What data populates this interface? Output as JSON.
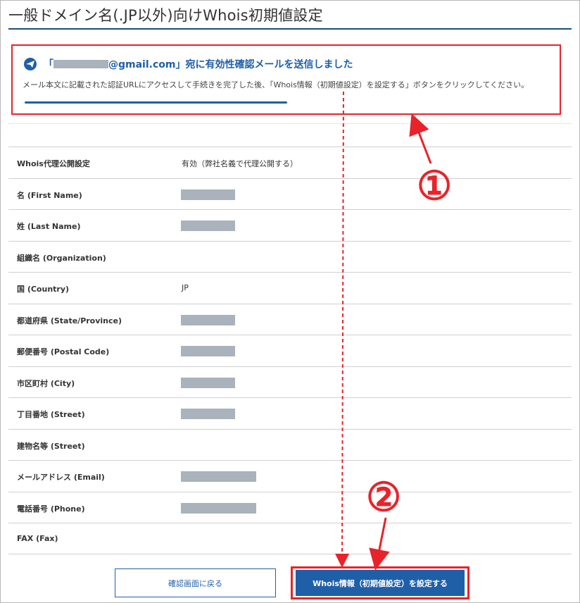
{
  "page": {
    "title": "一般ドメイン名(.JP以外)向けWhois初期値設定"
  },
  "notice": {
    "icon": "send-icon",
    "open_quote": "「",
    "email_suffix": "@gmail.com」宛に有効性確認メールを送信しました",
    "body": "メール本文に記載された認証URLにアクセスして手続きを完了した後、「Whois情報（初期値設定）を設定する」ボタンをクリックしてください。"
  },
  "rows": [
    {
      "label": "Whois代理公開設定",
      "value": "有効（弊社名義で代理公開する）"
    },
    {
      "label": "名 (First Name)",
      "value": ""
    },
    {
      "label": "姓 (Last Name)",
      "value": ""
    },
    {
      "label": "組織名 (Organization)",
      "value": ""
    },
    {
      "label": "国 (Country)",
      "value": "JP"
    },
    {
      "label": "都道府県 (State/Province)",
      "value": ""
    },
    {
      "label": "郵便番号 (Postal Code)",
      "value": ""
    },
    {
      "label": "市区町村 (City)",
      "value": ""
    },
    {
      "label": "丁目番地 (Street)",
      "value": ""
    },
    {
      "label": "建物名等 (Street)",
      "value": ""
    },
    {
      "label": "メールアドレス (Email)",
      "value": ""
    },
    {
      "label": "電話番号 (Phone)",
      "value": ""
    },
    {
      "label": "FAX (Fax)",
      "value": ""
    }
  ],
  "buttons": {
    "back_label": "確認画面に戻る",
    "submit_label": "Whois情報（初期値設定）を設定する"
  },
  "annotations": {
    "marker_1": "①",
    "marker_2": "②"
  },
  "colors": {
    "accent": "#1f5fa8",
    "highlight": "#e8232a",
    "mask": "#aab2bb"
  }
}
